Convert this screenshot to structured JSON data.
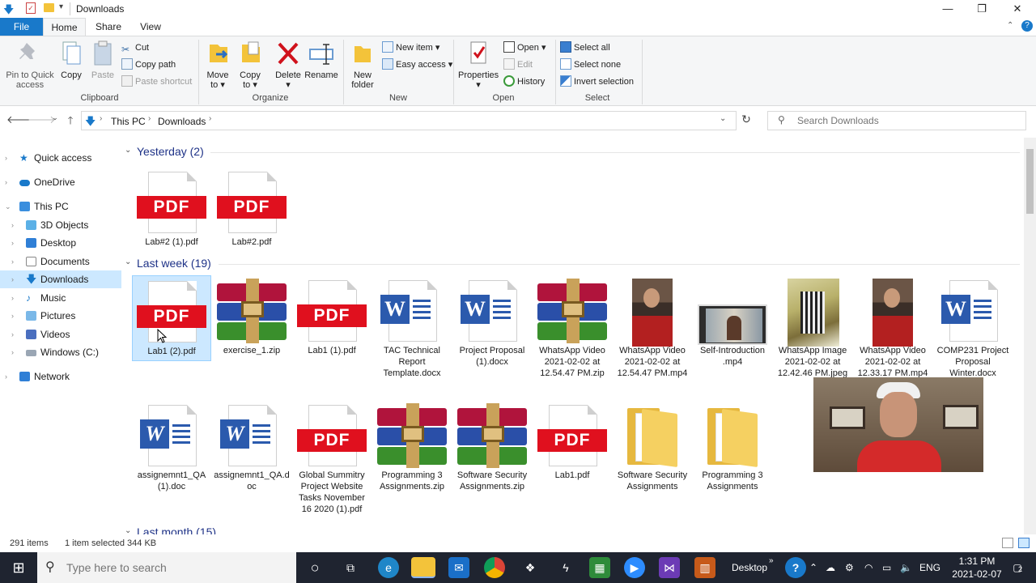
{
  "window": {
    "title": "Downloads",
    "min": "—",
    "max": "❐",
    "close": "✕"
  },
  "ribbon_tabs": [
    "File",
    "Home",
    "Share",
    "View"
  ],
  "clipboard": {
    "pin": [
      "Pin to Quick",
      "access"
    ],
    "copy": "Copy",
    "paste": "Paste",
    "cut": "Cut",
    "copy_path": "Copy path",
    "paste_shortcut": "Paste shortcut",
    "label": "Clipboard"
  },
  "organize": {
    "move": [
      "Move",
      "to ▾"
    ],
    "copy_to": [
      "Copy",
      "to ▾"
    ],
    "delete": [
      "Delete",
      "▾"
    ],
    "rename": "Rename",
    "label": "Organize"
  },
  "new_group": {
    "new_folder": [
      "New",
      "folder"
    ],
    "new_item": "New item ▾",
    "easy_access": "Easy access ▾",
    "label": "New"
  },
  "open_group": {
    "properties": [
      "Properties",
      "▾"
    ],
    "open": "Open ▾",
    "edit": "Edit",
    "history": "History",
    "label": "Open"
  },
  "select_group": {
    "select_all": "Select all",
    "select_none": "Select none",
    "invert": "Invert selection",
    "label": "Select"
  },
  "address": {
    "crumbs": [
      "This PC",
      "Downloads"
    ],
    "search_placeholder": "Search Downloads"
  },
  "nav": {
    "quick_access": "Quick access",
    "onedrive": "OneDrive",
    "this_pc": "This PC",
    "objects": "3D Objects",
    "desktop": "Desktop",
    "documents": "Documents",
    "downloads": "Downloads",
    "music": "Music",
    "pictures": "Pictures",
    "videos": "Videos",
    "windows_c": "Windows (C:)",
    "network": "Network"
  },
  "groups": {
    "yesterday": "Yesterday (2)",
    "last_week": "Last week (19)",
    "last_month": "Last month (15)"
  },
  "files": {
    "y1": "Lab#2 (1).pdf",
    "y2": "Lab#2.pdf",
    "w1": "Lab1 (2).pdf",
    "w2": "exercise_1.zip",
    "w3": "Lab1 (1).pdf",
    "w4": "TAC Technical Report Template.docx",
    "w5": "Project Proposal (1).docx",
    "w6": "WhatsApp Video 2021-02-02 at 12.54.47 PM.zip",
    "w7": "WhatsApp Video 2021-02-02 at 12.54.47 PM.mp4",
    "w8": "Self-Introduction .mp4",
    "w9": "WhatsApp Image 2021-02-02 at 12.42.46 PM.jpeg",
    "w10": "WhatsApp Video 2021-02-02 at 12.33.17 PM.mp4",
    "w11": "COMP231 Project Proposal Winter.docx",
    "r1": "assignemnt1_QA (1).doc",
    "r2": "assignemnt1_QA.doc",
    "r3": "Global Summitry Project Website Tasks November 16 2020 (1).pdf",
    "r4": "Programming 3 Assignments.zip",
    "r5": "Software Security Assignments.zip",
    "r6": "Lab1.pdf",
    "r7": "Software Security Assignments",
    "r8": "Programming 3 Assignments"
  },
  "pdf_badge": "PDF",
  "word_badge": "W",
  "status": {
    "count": "291 items",
    "selected": "1 item selected  344 KB"
  },
  "taskbar": {
    "search_placeholder": "Type here to search",
    "desktop": "Desktop",
    "lang": "ENG",
    "time": "1:31 PM",
    "date": "2021-02-07",
    "notif": "2"
  },
  "colors": {
    "accent": "#1979ca",
    "selection": "#cce8ff",
    "pdf_red": "#e0101e",
    "word_blue": "#2b5aad",
    "group_head": "#1e3287"
  }
}
